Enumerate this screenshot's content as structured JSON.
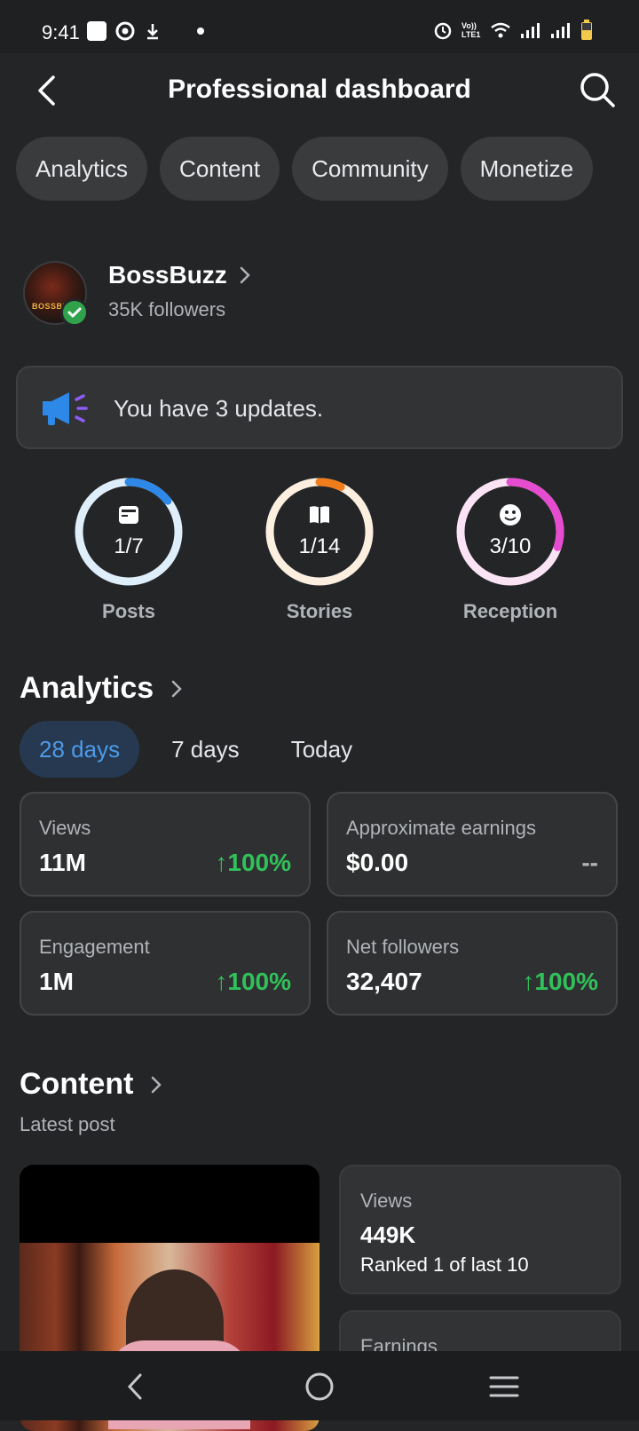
{
  "status_bar": {
    "time": "9:41",
    "network_label": "Vo)) LTE1"
  },
  "header": {
    "title": "Professional dashboard"
  },
  "chips": [
    {
      "label": "Analytics"
    },
    {
      "label": "Content"
    },
    {
      "label": "Community"
    },
    {
      "label": "Monetize"
    }
  ],
  "profile": {
    "name": "BossBuzz",
    "followers": "35K followers",
    "avatar_text": "BOSSBUZZ"
  },
  "updates": {
    "text": "You have 3 updates."
  },
  "rings": [
    {
      "label": "Posts",
      "value": "1/7",
      "progress": 0.143,
      "color": "#2d88e8",
      "track": "#dfeefb",
      "icon": "post-icon"
    },
    {
      "label": "Stories",
      "value": "1/14",
      "progress": 0.071,
      "color": "#f07c1c",
      "track": "#fcefe0",
      "icon": "book-icon"
    },
    {
      "label": "Reception",
      "value": "3/10",
      "progress": 0.3,
      "color": "#e64ccf",
      "track": "#fbe3f6",
      "icon": "smile-icon"
    }
  ],
  "analytics": {
    "title": "Analytics",
    "ranges": [
      {
        "label": "28 days",
        "active": true
      },
      {
        "label": "7 days",
        "active": false
      },
      {
        "label": "Today",
        "active": false
      }
    ],
    "metrics": [
      {
        "label": "Views",
        "value": "11M",
        "delta": "100%"
      },
      {
        "label": "Approximate earnings",
        "value": "$0.00",
        "delta": "--"
      },
      {
        "label": "Engagement",
        "value": "1M",
        "delta": "100%"
      },
      {
        "label": "Net followers",
        "value": "32,407",
        "delta": "100%"
      }
    ]
  },
  "content": {
    "title": "Content",
    "latest_label": "Latest post",
    "views_card": {
      "label": "Views",
      "value": "449K",
      "sub": "Ranked 1 of last 10"
    },
    "earnings_card": {
      "label": "Earnings"
    }
  },
  "colors": {
    "background": "#242527",
    "accent_blue": "#4d9be8",
    "positive_green": "#31c15a"
  }
}
